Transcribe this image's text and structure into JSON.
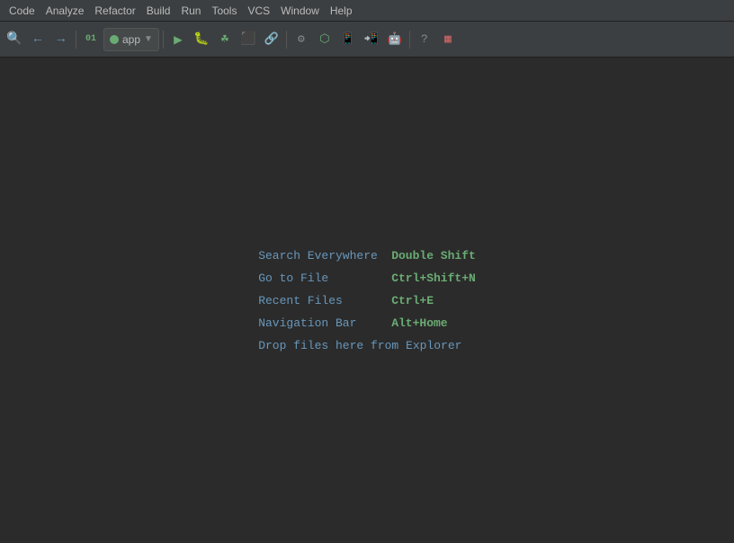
{
  "menubar": {
    "items": [
      {
        "label": "Code"
      },
      {
        "label": "Analyze"
      },
      {
        "label": "Refactor"
      },
      {
        "label": "Build"
      },
      {
        "label": "Run"
      },
      {
        "label": "Tools"
      },
      {
        "label": "VCS"
      },
      {
        "label": "Window"
      },
      {
        "label": "Help"
      }
    ]
  },
  "toolbar": {
    "app_name": "app",
    "buttons": [
      {
        "name": "search-icon",
        "symbol": "🔍"
      },
      {
        "name": "back-icon",
        "symbol": "←"
      },
      {
        "name": "forward-icon",
        "symbol": "→"
      },
      {
        "name": "code-icon",
        "symbol": "01"
      },
      {
        "name": "android-icon",
        "symbol": "🤖"
      },
      {
        "name": "play-icon",
        "symbol": "▶"
      },
      {
        "name": "debug-icon",
        "symbol": "🐞"
      },
      {
        "name": "run-coverage-icon",
        "symbol": "☘"
      },
      {
        "name": "stop-icon",
        "symbol": "⬛"
      },
      {
        "name": "attach-icon",
        "symbol": "📎"
      },
      {
        "name": "attach2-icon",
        "symbol": "⚙"
      },
      {
        "name": "sdkman-icon",
        "symbol": "⬡"
      },
      {
        "name": "avd-icon",
        "symbol": "📱"
      },
      {
        "name": "device-icon",
        "symbol": "📟"
      },
      {
        "name": "android2-icon",
        "symbol": "🤖"
      },
      {
        "name": "help-icon",
        "symbol": "?"
      },
      {
        "name": "layout-icon",
        "symbol": "▦"
      }
    ]
  },
  "hints": {
    "rows": [
      {
        "action": "Search Everywhere",
        "shortcut": "Double Shift"
      },
      {
        "action": "Go to File",
        "shortcut": "Ctrl+Shift+N"
      },
      {
        "action": "Recent Files",
        "shortcut": "Ctrl+E"
      },
      {
        "action": "Navigation Bar",
        "shortcut": "Alt+Home"
      },
      {
        "action": "Drop files here from Explorer",
        "shortcut": ""
      }
    ]
  }
}
